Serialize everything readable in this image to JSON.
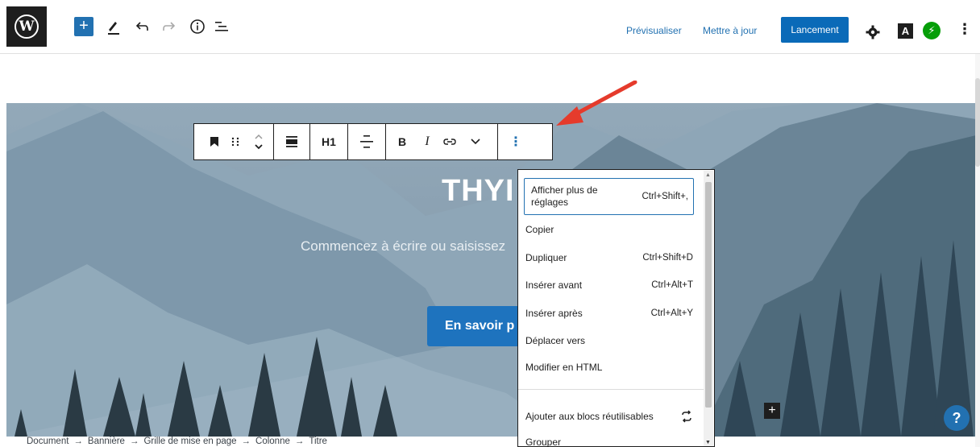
{
  "topbar": {
    "preview_label": "Prévisualiser",
    "update_label": "Mettre à jour",
    "publish_label": "Lancement",
    "astra_label": "A"
  },
  "hero": {
    "title": "THYI",
    "subtitle": "Commencez à écrire ou saisissez",
    "button_label": "En savoir p"
  },
  "block_toolbar": {
    "heading_level": "H1",
    "bold": "B",
    "italic": "I"
  },
  "menu": {
    "items": [
      {
        "label": "Afficher plus de réglages",
        "shortcut": "Ctrl+Shift+,"
      },
      {
        "label": "Copier",
        "shortcut": ""
      },
      {
        "label": "Dupliquer",
        "shortcut": "Ctrl+Shift+D"
      },
      {
        "label": "Insérer avant",
        "shortcut": "Ctrl+Alt+T"
      },
      {
        "label": "Insérer après",
        "shortcut": "Ctrl+Alt+Y"
      },
      {
        "label": "Déplacer vers",
        "shortcut": ""
      },
      {
        "label": "Modifier en HTML",
        "shortcut": ""
      },
      {
        "label": "Ajouter aux blocs réutilisables",
        "shortcut": ""
      },
      {
        "label": "Grouper",
        "shortcut": ""
      }
    ]
  },
  "breadcrumb": {
    "items": [
      "Document",
      "Bannière",
      "Grille de mise en page",
      "Colonne",
      "Titre"
    ],
    "separator": "→"
  },
  "help_label": "?",
  "colors": {
    "accent": "#2271b1",
    "publish": "#0a6ab8",
    "jetpack": "#069e08",
    "arrow": "#e53b2c"
  }
}
